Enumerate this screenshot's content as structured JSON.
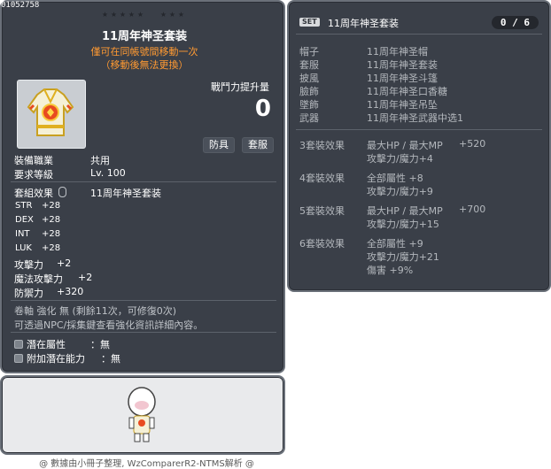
{
  "item_id": "01052758",
  "item": {
    "name": "11周年神圣套装",
    "trade_note_1": "僅可在同帳號間移動一次",
    "trade_note_2": "（移動後無法更換）",
    "power_label": "戰鬥力提升量",
    "power_value": "0",
    "tags": [
      "防具",
      "套服"
    ],
    "job_label": "裝備職業",
    "job_value": "共用",
    "level_label": "要求等級",
    "level_value": "Lv. 100",
    "set_label": "套組效果",
    "set_value": "11周年神圣套装",
    "stats": [
      {
        "name": "STR",
        "value": "+28"
      },
      {
        "name": "DEX",
        "value": "+28"
      },
      {
        "name": "INT",
        "value": "+28"
      },
      {
        "name": "LUK",
        "value": "+28"
      }
    ],
    "attack_label": "攻擊力",
    "attack_value": "+2",
    "magic_label": "魔法攻擊力",
    "magic_value": "+2",
    "defense_label": "防禦力",
    "defense_value": "+320",
    "scroll_text": "卷軸 強化 無 (剩餘11次，可修復0次)",
    "npc_text": "可透過NPC/採集鍵查看強化資訊詳細內容。",
    "potential_label": "潛在屬性",
    "potential_value": "：無",
    "add_potential_label": "附加潛在能力",
    "add_potential_value": "：無"
  },
  "set_panel": {
    "badge": "SET",
    "name": "11周年神圣套装",
    "count": "0 / 6",
    "items": [
      {
        "slot": "帽子",
        "name": "11周年神圣帽"
      },
      {
        "slot": "套服",
        "name": "11周年神圣套装"
      },
      {
        "slot": "披風",
        "name": "11周年神圣斗篷"
      },
      {
        "slot": "臉飾",
        "name": "11周年神圣口香糖"
      },
      {
        "slot": "墜飾",
        "name": "11周年神圣吊坠"
      },
      {
        "slot": "武器",
        "name": "11周年神圣武器中选1"
      }
    ],
    "effects": [
      {
        "label": "3套裝效果",
        "lines": [
          {
            "text": "最大HP / 最大MP",
            "num": "+520"
          },
          {
            "text": "攻擊力/魔力+4",
            "num": ""
          }
        ]
      },
      {
        "label": "4套裝效果",
        "lines": [
          {
            "text": "全部屬性 +8",
            "num": ""
          },
          {
            "text": "攻擊力/魔力+9",
            "num": ""
          }
        ]
      },
      {
        "label": "5套裝效果",
        "lines": [
          {
            "text": "最大HP / 最大MP",
            "num": "+700"
          },
          {
            "text": "攻擊力/魔力+15",
            "num": ""
          }
        ]
      },
      {
        "label": "6套裝效果",
        "lines": [
          {
            "text": "全部屬性 +9",
            "num": ""
          },
          {
            "text": "攻擊力/魔力+21",
            "num": ""
          },
          {
            "text": "傷害 +9%",
            "num": ""
          }
        ]
      }
    ]
  },
  "footer": "@ 數據由小冊子整理, WzComparerR2-NTMS解析 @",
  "colors": {
    "panel_bg": "#3a3f48",
    "accent_orange": "#ff9a32",
    "muted": "#b4b8bd"
  }
}
